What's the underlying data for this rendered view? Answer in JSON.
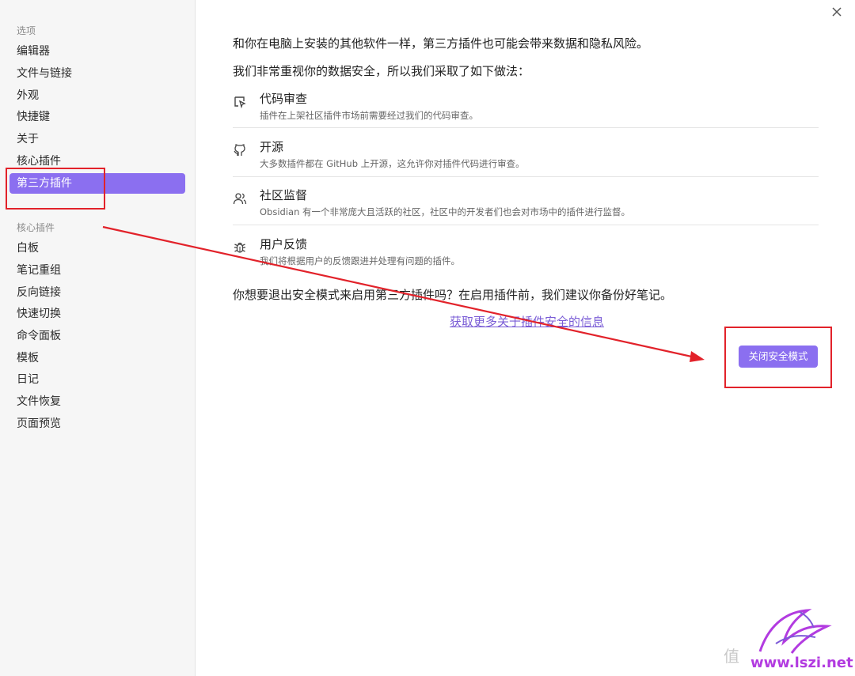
{
  "sidebar": {
    "section_options": "选项",
    "options_items": [
      "编辑器",
      "文件与链接",
      "外观",
      "快捷键",
      "关于",
      "核心插件",
      "第三方插件"
    ],
    "active_index": 6,
    "section_core": "核心插件",
    "core_items": [
      "白板",
      "笔记重组",
      "反向链接",
      "快速切换",
      "命令面板",
      "模板",
      "日记",
      "文件恢复",
      "页面预览"
    ]
  },
  "main": {
    "intro1": "和你在电脑上安装的其他软件一样，第三方插件也可能会带来数据和隐私风险。",
    "intro2": "我们非常重视你的数据安全，所以我们采取了如下做法：",
    "features": [
      {
        "icon": "code-review-icon",
        "title": "代码审查",
        "desc": "插件在上架社区插件市场前需要经过我们的代码审查。"
      },
      {
        "icon": "github-icon",
        "title": "开源",
        "desc": "大多数插件都在 GitHub 上开源，这允许你对插件代码进行审查。"
      },
      {
        "icon": "users-icon",
        "title": "社区监督",
        "desc": "Obsidian 有一个非常庞大且活跃的社区，社区中的开发者们也会对市场中的插件进行监督。"
      },
      {
        "icon": "bug-icon",
        "title": "用户反馈",
        "desc": "我们将根据用户的反馈跟进并处理有问题的插件。"
      }
    ],
    "question": "你想要退出安全模式来启用第三方插件吗？在启用插件前，我们建议你备份好笔记。",
    "link": "获取更多关于插件安全的信息",
    "button": "关闭安全模式",
    "close_icon": "close-icon"
  },
  "watermark": {
    "prefix": "值",
    "url": "www.lszi.net"
  },
  "colors": {
    "accent": "#8b6ff0",
    "annotation": "#e2222a",
    "link": "#7a5cd6"
  }
}
